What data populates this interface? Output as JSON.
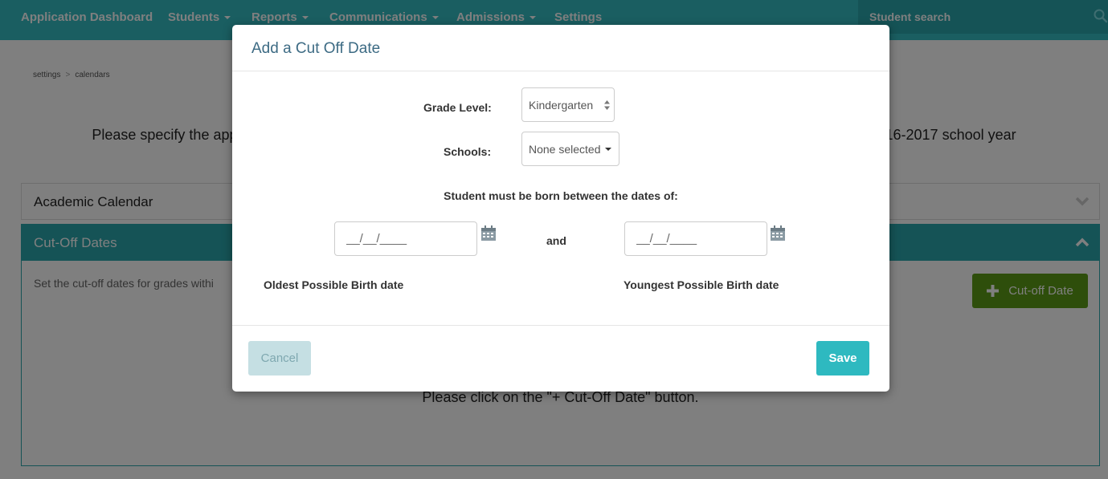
{
  "nav": {
    "items": [
      {
        "label": "Application Dashboard",
        "dropdown": false
      },
      {
        "label": "Students",
        "dropdown": true
      },
      {
        "label": "Reports",
        "dropdown": true
      },
      {
        "label": "Communications",
        "dropdown": true
      },
      {
        "label": "Admissions",
        "dropdown": true
      },
      {
        "label": "Settings",
        "dropdown": false
      }
    ],
    "search_placeholder": "Student search",
    "search_icon": "search-icon"
  },
  "breadcrumb": {
    "items": [
      "settings",
      "calendars"
    ],
    "separator": ">"
  },
  "page": {
    "instruction_left": "Please specify the app",
    "instruction_right": "016-2017 school year",
    "academic_panel_title": "Academic Calendar",
    "cutoff_panel_title": "Cut-Off Dates",
    "cutoff_description": "Set the cut-off dates for grades withi",
    "add_cutoff_label": "Cut-off Date",
    "empty_message": "Please click on the \"+ Cut-Off Date\" button."
  },
  "modal": {
    "title": "Add a Cut Off Date",
    "grade_level_label": "Grade Level:",
    "grade_level_value": "Kindergarten",
    "schools_label": "Schools:",
    "schools_value": "None selected",
    "born_between_label": "Student must be born between the dates of:",
    "date_placeholder": "__/__/____",
    "and_label": "and",
    "oldest_label": "Oldest Possible Birth date",
    "youngest_label": "Youngest Possible Birth date",
    "cancel_label": "Cancel",
    "save_label": "Save"
  },
  "colors": {
    "nav": "#34bcc3",
    "search_bg": "#2ba6ad",
    "panel_header": "#2ba6ad",
    "add_button": "#5c9c17",
    "save_button": "#2eb9c0",
    "cancel_button": "#c5dfe3",
    "modal_title": "#3d6b84"
  }
}
